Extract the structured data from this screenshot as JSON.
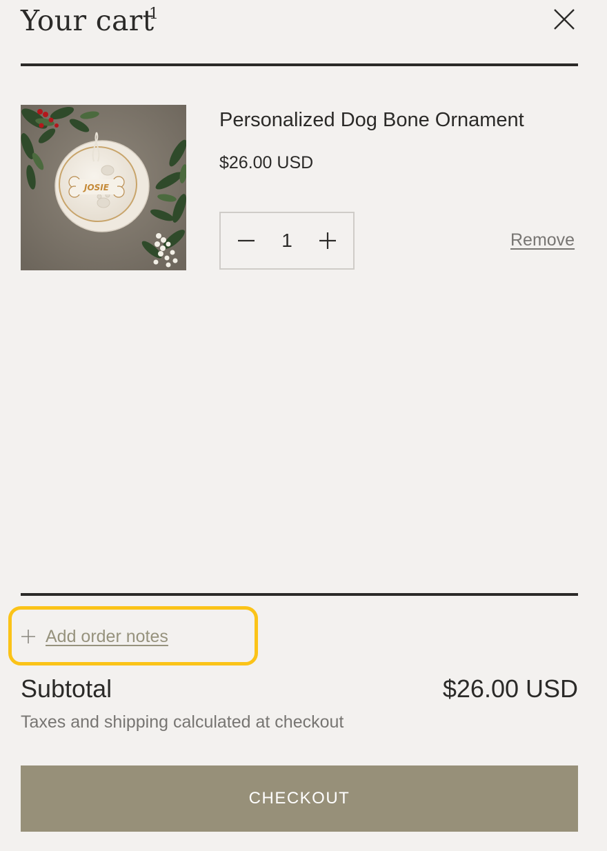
{
  "header": {
    "title": "Your cart",
    "count": "1",
    "close_icon": "close-icon"
  },
  "line_item": {
    "name": "Personalized Dog Bone Ornament",
    "price": "$26.00 USD",
    "quantity": "1",
    "remove_label": "Remove",
    "decrease_icon": "minus-icon",
    "increase_icon": "plus-icon"
  },
  "notes": {
    "label": "Add order notes",
    "icon": "plus-icon",
    "highlight_color": "#fbc318"
  },
  "totals": {
    "subtotal_label": "Subtotal",
    "subtotal_value": "$26.00 USD",
    "tax_note": "Taxes and shipping calculated at checkout"
  },
  "checkout": {
    "label": "CHECKOUT",
    "color": "#979079"
  }
}
